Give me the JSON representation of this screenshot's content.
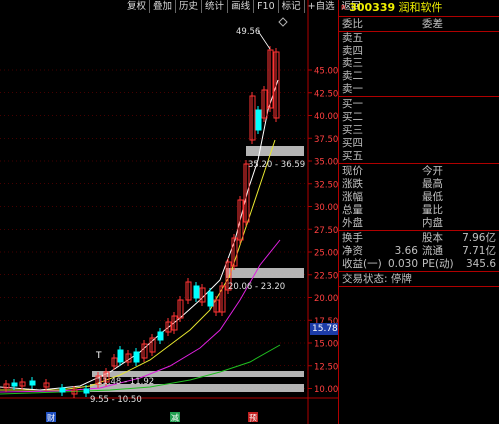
{
  "toolbar": [
    "复权",
    "叠加",
    "历史",
    "统计",
    "画线",
    "F10",
    "标记",
    "+自选",
    "返回"
  ],
  "y_axis": {
    "ticks": [
      "45.00",
      "42.50",
      "40.00",
      "37.50",
      "35.00",
      "32.50",
      "30.00",
      "27.50",
      "25.00",
      "22.50",
      "20.00",
      "17.50",
      "15.00",
      "12.50",
      "10.00"
    ],
    "current_price": "15.78"
  },
  "chart_annotations": {
    "peak": "49.56",
    "zone_high": "35.20 - 36.59",
    "zone_mid": "20.06 - 23.20",
    "zone_low1": "11.48 - 11.92",
    "zone_low2": "9.55 - 10.50",
    "marker_t": "T"
  },
  "bottom_markers": [
    "财",
    "减",
    "预"
  ],
  "colors": {
    "up": "#ff3333",
    "down": "#00ffff",
    "ma5": "#ffffff",
    "ma10": "#e8e830",
    "ma20": "#e020e0",
    "ma60": "#20c020",
    "grid": "#8b0000",
    "zone": "#c8c8c8"
  },
  "panel": {
    "code": "300339",
    "name": "润和软件",
    "code_marker": "R",
    "header_left": "委比",
    "header_right": "委差",
    "sell": [
      "卖五",
      "卖四",
      "卖三",
      "卖二",
      "卖一"
    ],
    "buy": [
      "买一",
      "买二",
      "买三",
      "买四",
      "买五"
    ],
    "quote_left": [
      "现价",
      "涨跌",
      "涨幅",
      "总量",
      "外盘"
    ],
    "quote_right": [
      "今开",
      "最高",
      "最低",
      "量比",
      "内盘"
    ],
    "stats": [
      {
        "l1": "换手",
        "v1": "",
        "l2": "股本",
        "v2": "7.96亿"
      },
      {
        "l1": "净资",
        "v1": "3.66",
        "l2": "流通",
        "v2": "7.71亿"
      },
      {
        "l1": "收益(一)",
        "v1": "0.030",
        "l2": "PE(动)",
        "v2": "345.6"
      }
    ],
    "trade_status_label": "交易状态:",
    "trade_status_value": "停牌"
  }
}
